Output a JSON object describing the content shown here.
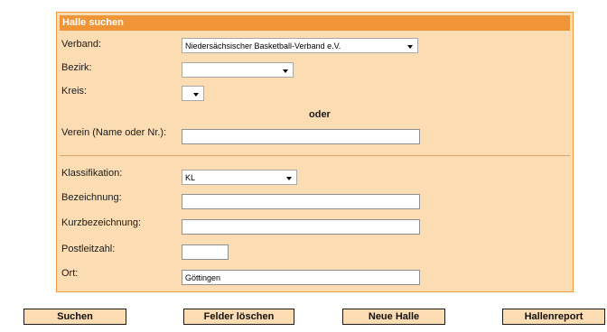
{
  "panel": {
    "title": "Halle suchen"
  },
  "fields": {
    "verband": {
      "label": "Verband:",
      "value": "Niedersächsischer Basketball-Verband e.V."
    },
    "bezirk": {
      "label": "Bezirk:",
      "value": ""
    },
    "kreis": {
      "label": "Kreis:",
      "value": ""
    },
    "oder": "oder",
    "verein": {
      "label": "Verein (Name oder Nr.):",
      "value": ""
    },
    "klassifikation": {
      "label": "Klassifikation:",
      "value": "KL"
    },
    "bezeichnung": {
      "label": "Bezeichnung:",
      "value": ""
    },
    "kurzbezeichnung": {
      "label": "Kurzbezeichnung:",
      "value": ""
    },
    "postleitzahl": {
      "label": "Postleitzahl:",
      "value": ""
    },
    "ort": {
      "label": "Ort:",
      "value": "Göttingen"
    }
  },
  "buttons": {
    "suchen": "Suchen",
    "felder_loeschen": "Felder löschen",
    "neue_halle": "Neue Halle",
    "hallenreport": "Hallenreport"
  },
  "colors": {
    "panel_bg": "#fcdcb2",
    "header_bg": "#f09438",
    "border": "#ee9a3e"
  }
}
